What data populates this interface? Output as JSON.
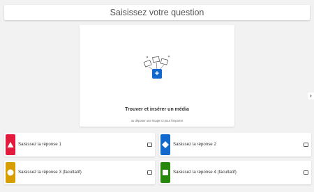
{
  "question": {
    "placeholder": "Saisissez votre question"
  },
  "media": {
    "label": "Trouver et insérer un média",
    "caption": "ou déposer une image ici pour l'importer",
    "add_icon": "plus-icon",
    "add_color": "#1368ce"
  },
  "navigation": {
    "next_icon": "chevron-right-icon"
  },
  "answers": [
    {
      "placeholder": "Saisissez la réponse 1",
      "shape": "triangle",
      "color": "#e21b3c"
    },
    {
      "placeholder": "Saisissez la réponse 2",
      "shape": "diamond",
      "color": "#1368ce"
    },
    {
      "placeholder": "Saisissez la réponse 3 (facultatif)",
      "shape": "circle",
      "color": "#d89e00"
    },
    {
      "placeholder": "Saisissez la réponse 4 (facultatif)",
      "shape": "square",
      "color": "#26890c"
    }
  ]
}
